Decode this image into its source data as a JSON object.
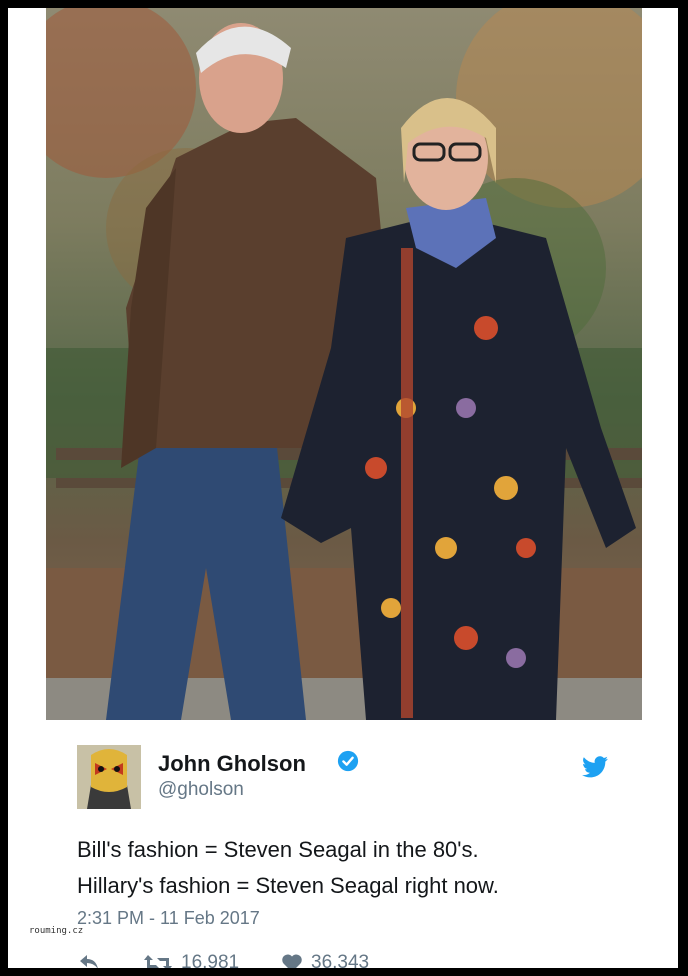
{
  "tweet": {
    "name": "John Gholson",
    "handle": "@gholson",
    "text_line1": "Bill's fashion = Steven Seagal in the 80's.",
    "text_line2": "Hillary's fashion = Steven Seagal right now.",
    "timestamp": "2:31 PM - 11 Feb 2017",
    "retweets": "16,981",
    "likes": "36,343"
  },
  "watermark": "rouming.cz",
  "colors": {
    "verified": "#1da1f2",
    "twitter_bird": "#1da1f2",
    "text": "#14171a",
    "muted": "#657786"
  },
  "icons": {
    "reply": "reply-icon",
    "retweet": "retweet-icon",
    "like": "heart-icon",
    "verified": "verified-badge-icon",
    "brand": "twitter-bird-icon"
  }
}
